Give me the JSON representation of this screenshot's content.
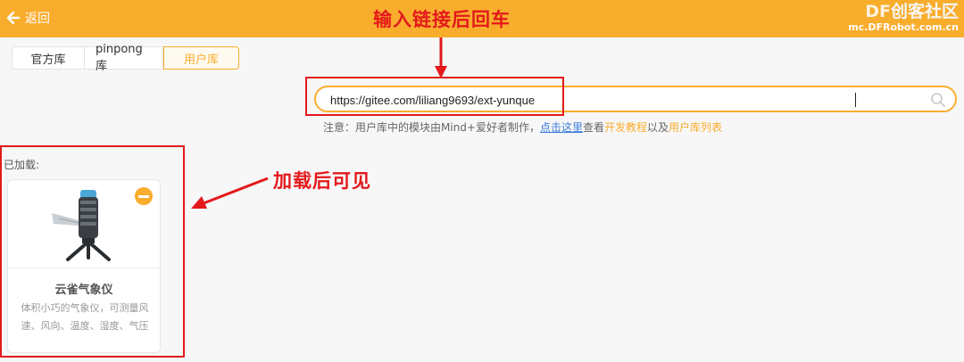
{
  "header": {
    "back_label": "返回",
    "annotation": "输入链接后回车",
    "brand_df": "DF",
    "brand_cn": "创客社区",
    "brand_url": "mc.DFRobot.com.cn"
  },
  "tabs": [
    {
      "label": "官方库",
      "active": false
    },
    {
      "label": "pinpong库",
      "active": false
    },
    {
      "label": "用户库",
      "active": true
    }
  ],
  "search": {
    "value": "https://gitee.com/liliang9693/ext-yunque"
  },
  "notice": {
    "prefix": "注意：用户库中的模块由Mind+爱好者制作，",
    "click_here": "点击这里",
    "view": "查看",
    "dev_tutorial": "开发教程",
    "and": "以及",
    "user_lib_list": "用户库列表"
  },
  "loaded": {
    "label": "已加载:",
    "annotation": "加载后可见",
    "cards": [
      {
        "title": "云雀气象仪",
        "desc_line1": "体积小巧的气象仪，可测量风",
        "desc_line2": "速、风向、温度、湿度、气压"
      }
    ]
  },
  "colors": {
    "accent": "#f9ad2d",
    "annotation_red": "#e3191c",
    "link_blue": "#3a7bdc"
  }
}
